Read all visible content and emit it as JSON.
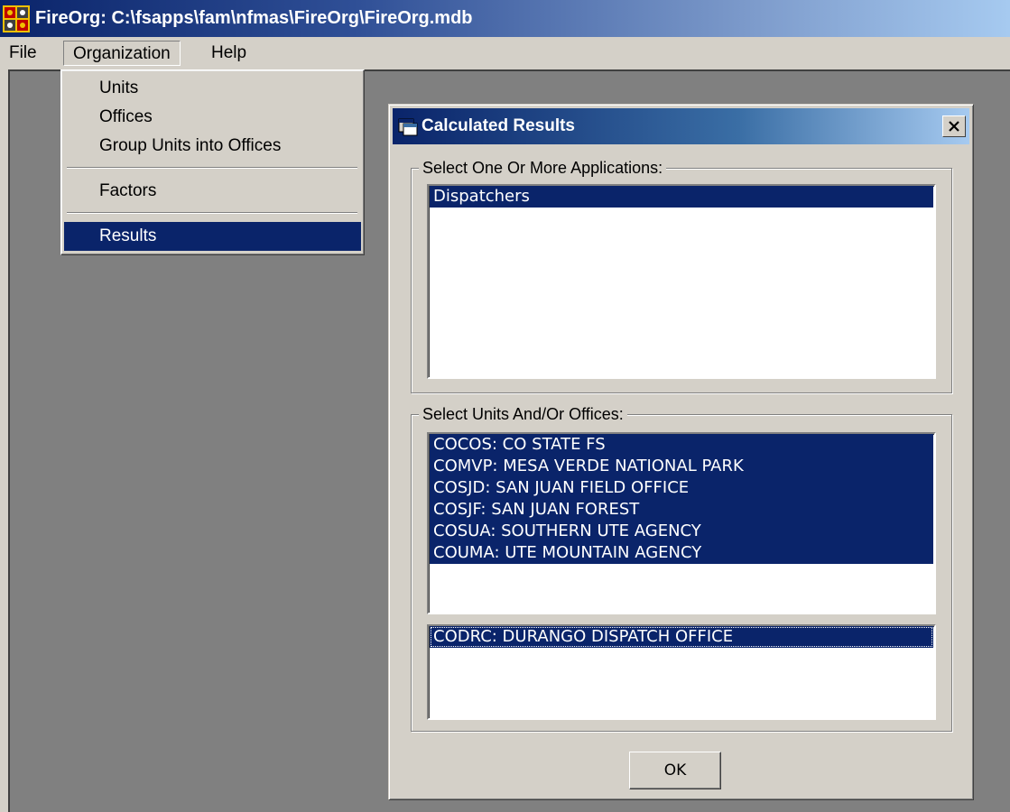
{
  "window": {
    "title": "FireOrg: C:\\fsapps\\fam\\nfmas\\FireOrg\\FireOrg.mdb"
  },
  "menubar": {
    "file": "File",
    "organization": "Organization",
    "help": "Help"
  },
  "organization_menu": {
    "items": [
      "Units",
      "Offices",
      "Group Units into Offices",
      "Factors",
      "Results"
    ],
    "selected": "Results"
  },
  "dialog": {
    "title": "Calculated Results",
    "close_label": "X",
    "applications_label": "Select One Or More Applications:",
    "applications": [
      {
        "label": "Dispatchers",
        "selected": true
      }
    ],
    "units_label": "Select Units And/Or Offices:",
    "units": [
      {
        "label": "COCOS: CO STATE FS",
        "selected": true
      },
      {
        "label": "COMVP: MESA VERDE NATIONAL PARK",
        "selected": true
      },
      {
        "label": "COSJD: SAN JUAN FIELD OFFICE",
        "selected": true
      },
      {
        "label": "COSJF: SAN JUAN FOREST",
        "selected": true
      },
      {
        "label": "COSUA: SOUTHERN UTE AGENCY",
        "selected": true
      },
      {
        "label": "COUMA: UTE MOUNTAIN AGENCY",
        "selected": true
      }
    ],
    "offices": [
      {
        "label": "CODRC: DURANGO DISPATCH OFFICE",
        "selected": true,
        "focused": true
      }
    ],
    "ok_label": "OK"
  },
  "colors": {
    "selection": "#0a246a",
    "face": "#d4d0c8",
    "workspace": "#808080"
  }
}
